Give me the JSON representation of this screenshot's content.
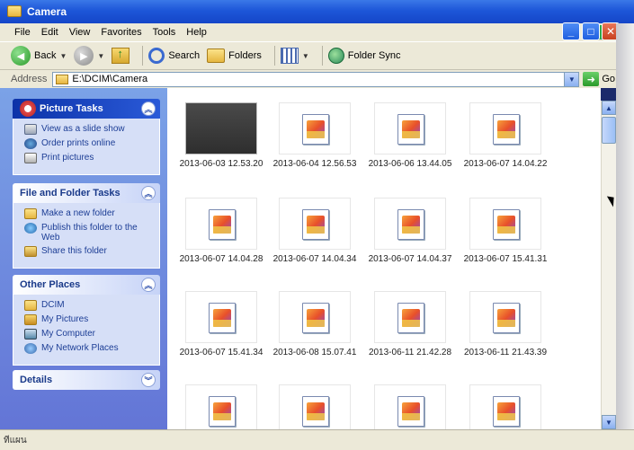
{
  "window": {
    "title": "Camera"
  },
  "title_buttons": {
    "minimize": "_",
    "maximize": "□",
    "close": "✕"
  },
  "menu": [
    "File",
    "Edit",
    "View",
    "Favorites",
    "Tools",
    "Help"
  ],
  "toolbar": {
    "back": "Back",
    "search": "Search",
    "folders": "Folders",
    "folder_sync": "Folder Sync"
  },
  "address": {
    "label": "Address",
    "value": "E:\\DCIM\\Camera",
    "go": "Go"
  },
  "picture_tasks": {
    "title": "Picture Tasks",
    "items": [
      "View as a slide show",
      "Order prints online",
      "Print pictures"
    ]
  },
  "file_folder_tasks": {
    "title": "File and Folder Tasks",
    "items": [
      "Make a new folder",
      "Publish this folder to the Web",
      "Share this folder"
    ]
  },
  "other_places": {
    "title": "Other Places",
    "items": [
      "DCIM",
      "My Pictures",
      "My Computer",
      "My Network Places"
    ]
  },
  "details": {
    "title": "Details"
  },
  "files": [
    "2013-06-03 12.53.20",
    "2013-06-04 12.56.53",
    "2013-06-06 13.44.05",
    "2013-06-07 14.04.22",
    "2013-06-07 14.04.28",
    "2013-06-07 14.04.34",
    "2013-06-07 14.04.37",
    "2013-06-07 15.41.31",
    "2013-06-07 15.41.34",
    "2013-06-08 15.07.41",
    "2013-06-11 21.42.28",
    "2013-06-11 21.43.39"
  ],
  "status": {
    "text": "ทีแผน"
  }
}
